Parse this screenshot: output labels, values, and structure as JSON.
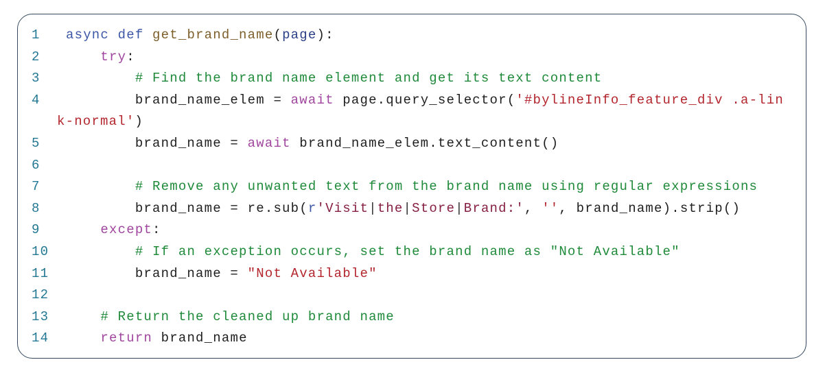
{
  "code_block": {
    "language": "python",
    "lines": [
      {
        "number": "1",
        "tokens": [
          {
            "t": "async def",
            "c": "kw"
          },
          {
            "t": " ",
            "c": ""
          },
          {
            "t": "get_brand_name",
            "c": "fn"
          },
          {
            "t": "(",
            "c": ""
          },
          {
            "t": "page",
            "c": "param"
          },
          {
            "t": "):",
            "c": ""
          }
        ]
      },
      {
        "number": "2",
        "tokens": [
          {
            "t": "    ",
            "c": ""
          },
          {
            "t": "try",
            "c": "ctl"
          },
          {
            "t": ":",
            "c": ""
          }
        ]
      },
      {
        "number": "3",
        "tokens": [
          {
            "t": "        ",
            "c": ""
          },
          {
            "t": "# Find the brand name element and get its text content",
            "c": "cm"
          }
        ]
      },
      {
        "number": "4",
        "tokens": [
          {
            "t": "        brand_name_elem = ",
            "c": ""
          },
          {
            "t": "await",
            "c": "ctl"
          },
          {
            "t": " page.query_selector(",
            "c": ""
          },
          {
            "t": "'#bylineInfo_feature_div .a-lin",
            "c": "str"
          }
        ]
      },
      {
        "number": "",
        "continuation": true,
        "tokens": [
          {
            "t": "k-normal'",
            "c": "str"
          },
          {
            "t": ")",
            "c": ""
          }
        ]
      },
      {
        "number": "5",
        "tokens": [
          {
            "t": "        brand_name = ",
            "c": ""
          },
          {
            "t": "await",
            "c": "ctl"
          },
          {
            "t": " brand_name_elem.text_content()",
            "c": ""
          }
        ]
      },
      {
        "number": "6",
        "tokens": []
      },
      {
        "number": "7",
        "tokens": [
          {
            "t": "        ",
            "c": ""
          },
          {
            "t": "# Remove any unwanted text from the brand name using regular expressions",
            "c": "cm"
          }
        ]
      },
      {
        "number": "8",
        "tokens": [
          {
            "t": "        brand_name = re.sub(",
            "c": ""
          },
          {
            "t": "r",
            "c": "kw"
          },
          {
            "t": "'Visit",
            "c": "rx"
          },
          {
            "t": "|",
            "c": "pipe"
          },
          {
            "t": "the",
            "c": "rx"
          },
          {
            "t": "|",
            "c": "pipe"
          },
          {
            "t": "Store",
            "c": "rx"
          },
          {
            "t": "|",
            "c": "pipe"
          },
          {
            "t": "Brand:'",
            "c": "rx"
          },
          {
            "t": ", ",
            "c": ""
          },
          {
            "t": "''",
            "c": "str"
          },
          {
            "t": ", brand_name).strip()",
            "c": ""
          }
        ]
      },
      {
        "number": "9",
        "tokens": [
          {
            "t": "    ",
            "c": ""
          },
          {
            "t": "except",
            "c": "ctl"
          },
          {
            "t": ":",
            "c": ""
          }
        ]
      },
      {
        "number": "10",
        "tokens": [
          {
            "t": "        ",
            "c": ""
          },
          {
            "t": "# If an exception occurs, set the brand name as \"Not Available\"",
            "c": "cm"
          }
        ]
      },
      {
        "number": "11",
        "tokens": [
          {
            "t": "        brand_name = ",
            "c": ""
          },
          {
            "t": "\"Not Available\"",
            "c": "str"
          }
        ]
      },
      {
        "number": "12",
        "tokens": []
      },
      {
        "number": "13",
        "tokens": [
          {
            "t": "    ",
            "c": ""
          },
          {
            "t": "# Return the cleaned up brand name",
            "c": "cm"
          }
        ]
      },
      {
        "number": "14",
        "tokens": [
          {
            "t": "    ",
            "c": ""
          },
          {
            "t": "return",
            "c": "ctl"
          },
          {
            "t": " brand_name",
            "c": ""
          }
        ]
      }
    ]
  }
}
